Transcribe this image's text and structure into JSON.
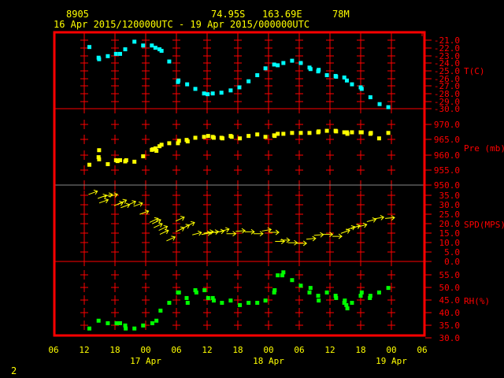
{
  "header": {
    "station": "8905",
    "lat": "74.95S",
    "lon": "163.69E",
    "elev": "78M",
    "period": "16 Apr 2015/120000UTC - 19 Apr 2015/000000UTC"
  },
  "footer": {
    "page_number": "2"
  },
  "colors": {
    "frame": "#ff0000",
    "temp": "#00ffff",
    "pres": "#ffff00",
    "wind": "#ffff00",
    "rh": "#00ff00",
    "text": "#ffff00"
  },
  "chart_data": {
    "type": "scatter",
    "x_unit": "hours since 16 Apr 2015 06UTC",
    "xlim": [
      0,
      72
    ],
    "x_ticks": [
      "06",
      "12",
      "18",
      "00",
      "06",
      "12",
      "18",
      "00",
      "06",
      "12",
      "18",
      "00",
      "06"
    ],
    "date_labels": [
      {
        "label": "17 Apr",
        "hour": 18
      },
      {
        "label": "18 Apr",
        "hour": 42
      },
      {
        "label": "19 Apr",
        "hour": 66
      }
    ],
    "panels": [
      {
        "name": "temperature",
        "label": "T(C)",
        "ylim": [
          -30,
          -21
        ],
        "ticks": [
          "-21.0",
          "-22.0",
          "-23.0",
          "-24.0",
          "-25.0",
          "-26.0",
          "-27.0",
          "-28.0",
          "-29.0",
          "-30.0"
        ],
        "x": [
          7.0,
          8.8,
          8.9,
          10.6,
          12.2,
          13.0,
          14.0,
          15.8,
          17.5,
          19.2,
          19.9,
          20.7,
          21.1,
          22.6,
          24.4,
          24.3,
          26.1,
          27.7,
          29.4,
          30.1,
          31.1,
          32.8,
          34.6,
          36.3,
          38.1,
          39.8,
          41.4,
          43.1,
          43.8,
          44.9,
          46.6,
          48.3,
          50.0,
          50.2,
          51.7,
          51.8,
          53.4,
          55.1,
          55.2,
          56.8,
          57.3,
          58.3,
          60.0,
          60.2,
          61.9,
          63.7,
          65.4
        ],
        "y": [
          -21.9,
          -23.3,
          -23.5,
          -23.1,
          -22.8,
          -22.8,
          -22.2,
          -21.2,
          -21.7,
          -21.7,
          -22.0,
          -22.2,
          -22.4,
          -23.8,
          -26.3,
          -26.5,
          -26.8,
          -27.4,
          -28.0,
          -28.1,
          -28.0,
          -27.9,
          -27.6,
          -27.2,
          -26.4,
          -25.6,
          -24.7,
          -24.2,
          -24.3,
          -24.0,
          -23.7,
          -24.0,
          -24.6,
          -24.8,
          -25.1,
          -24.9,
          -25.6,
          -25.7,
          -25.8,
          -25.9,
          -26.3,
          -26.8,
          -27.2,
          -27.4,
          -28.5,
          -29.4,
          -29.8
        ]
      },
      {
        "name": "pressure",
        "label": "Pre (mb)",
        "ylim": [
          950,
          975
        ],
        "ticks": [
          "970.0",
          "965.0",
          "960.0",
          "955.0",
          "950.0"
        ],
        "x": [
          7.0,
          8.8,
          8.9,
          8.9,
          10.6,
          12.2,
          12.5,
          13.0,
          14.0,
          14.2,
          15.8,
          17.5,
          19.2,
          19.4,
          19.9,
          20.1,
          20.7,
          21.1,
          22.6,
          24.3,
          24.5,
          26.0,
          26.2,
          27.7,
          29.4,
          30.2,
          31.1,
          31.3,
          32.8,
          33.0,
          34.6,
          34.8,
          36.4,
          38.1,
          39.8,
          41.4,
          43.1,
          43.2,
          43.8,
          44.9,
          46.6,
          48.3,
          50.0,
          51.7,
          51.8,
          53.4,
          55.1,
          55.2,
          56.8,
          57.3,
          57.4,
          58.3,
          60.0,
          60.2,
          61.9,
          62.0,
          63.6,
          65.4
        ],
        "y": [
          956.7,
          959.2,
          961.5,
          958.5,
          956.9,
          958.2,
          957.9,
          958.2,
          957.8,
          958.2,
          957.7,
          959.5,
          961.6,
          961.8,
          962.1,
          961.3,
          962.8,
          963.3,
          963.8,
          963.8,
          964.6,
          964.9,
          964.4,
          965.6,
          965.9,
          966.2,
          965.9,
          965.6,
          965.6,
          965.4,
          966.2,
          965.9,
          965.4,
          966.2,
          966.7,
          965.9,
          966.4,
          966.2,
          966.9,
          966.9,
          967.2,
          967.2,
          967.2,
          967.4,
          967.7,
          967.9,
          967.9,
          967.7,
          967.4,
          967.4,
          966.9,
          967.4,
          967.4,
          967.4,
          966.9,
          967.2,
          965.4,
          967.2
        ]
      },
      {
        "name": "wind_speed",
        "label": "SPD(MPS)",
        "ylim": [
          0,
          40
        ],
        "ticks": [
          "35.0",
          "30.0",
          "25.0",
          "20.0",
          "15.0",
          "10.0",
          "5.0",
          "0.0"
        ],
        "x": [
          7.7,
          9.5,
          10.6,
          11.6,
          9.8,
          12.7,
          13.4,
          14.0,
          15.2,
          16.5,
          17.7,
          19.6,
          20.1,
          20.4,
          21.4,
          21.6,
          22.9,
          24.7,
          24.7,
          25.7,
          26.7,
          28.0,
          29.8,
          30.3,
          31.3,
          32.4,
          33.4,
          34.7,
          36.5,
          38.3,
          40.0,
          41.6,
          43.1,
          44.2,
          45.2,
          46.7,
          48.5,
          50.3,
          51.8,
          53.6,
          55.4,
          57.0,
          58.0,
          59.0,
          60.3,
          62.1,
          63.6,
          65.7
        ],
        "y": [
          36.3,
          34.2,
          34.9,
          34.9,
          31.8,
          30.4,
          31.4,
          29.3,
          30.7,
          30.0,
          25.8,
          21.7,
          21.0,
          18.9,
          17.5,
          15.4,
          11.9,
          22.4,
          16.8,
          18.2,
          19.6,
          14.7,
          14.7,
          15.4,
          15.4,
          15.7,
          16.5,
          14.7,
          16.1,
          15.7,
          14.7,
          16.5,
          15.4,
          10.6,
          11.3,
          9.9,
          9.6,
          12.0,
          14.0,
          14.3,
          13.3,
          15.7,
          17.5,
          18.2,
          18.9,
          21.7,
          23.0,
          23.0
        ],
        "arrow_tilt_deg": [
          -20,
          -20,
          -15,
          -15,
          -20,
          -20,
          -25,
          -20,
          -25,
          -20,
          -20,
          -25,
          -25,
          -25,
          -25,
          -25,
          -25,
          -25,
          -25,
          -25,
          -25,
          -15,
          -10,
          -10,
          -10,
          -10,
          -15,
          0,
          -5,
          0,
          0,
          -10,
          0,
          0,
          0,
          0,
          0,
          -5,
          -5,
          0,
          0,
          -20,
          -20,
          -20,
          -15,
          -15,
          -10,
          -5
        ]
      },
      {
        "name": "relative_humidity",
        "label": "RH(%)",
        "ylim": [
          30,
          60
        ],
        "ticks": [
          "55.0",
          "50.0",
          "45.0",
          "40.0",
          "35.0",
          "30.0"
        ],
        "x": [
          7.0,
          8.8,
          10.6,
          12.3,
          13.0,
          14.0,
          14.1,
          15.8,
          17.5,
          19.3,
          20.1,
          20.9,
          22.6,
          24.3,
          24.5,
          26.0,
          26.2,
          27.7,
          27.9,
          29.5,
          30.2,
          31.1,
          31.3,
          32.9,
          34.6,
          36.4,
          38.1,
          39.8,
          41.4,
          43.1,
          43.2,
          43.8,
          44.7,
          44.9,
          46.6,
          48.3,
          50.0,
          50.2,
          51.7,
          51.8,
          53.4,
          55.1,
          55.2,
          56.8,
          56.9,
          57.2,
          57.4,
          58.3,
          60.0,
          60.2,
          61.8,
          61.9,
          63.6,
          65.4
        ],
        "y": [
          33.7,
          36.8,
          35.8,
          35.8,
          35.8,
          34.9,
          33.7,
          33.7,
          34.9,
          35.8,
          36.8,
          40.8,
          43.9,
          48.0,
          48.0,
          45.8,
          43.9,
          48.9,
          48.0,
          48.9,
          45.8,
          45.8,
          44.8,
          43.9,
          44.8,
          43.0,
          43.9,
          43.9,
          44.8,
          48.0,
          48.9,
          54.8,
          54.8,
          56.0,
          52.9,
          50.7,
          48.0,
          49.8,
          46.7,
          44.8,
          48.0,
          46.7,
          45.8,
          43.9,
          44.8,
          43.0,
          41.7,
          43.9,
          46.7,
          48.0,
          45.8,
          46.7,
          48.0,
          49.8
        ]
      }
    ]
  }
}
